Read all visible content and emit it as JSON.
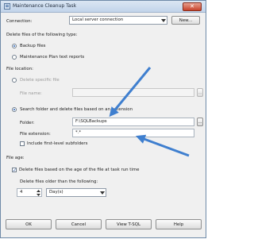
{
  "window": {
    "title": "Maintenance Cleanup Task",
    "close_label": "✕"
  },
  "connection": {
    "label": "Connection:",
    "selected": "Local server connection",
    "new_button": "New..."
  },
  "delete_type": {
    "heading": "Delete files of the following type:",
    "options": [
      {
        "label": "Backup files",
        "checked": true
      },
      {
        "label": "Maintenance Plan text reports",
        "checked": false
      }
    ]
  },
  "file_location": {
    "heading": "File location:",
    "specific": {
      "label": "Delete specific file",
      "checked": false
    },
    "file_name_label": "File name:",
    "file_name_value": "",
    "browse_label": "...",
    "search": {
      "label": "Search folder and delete files based on an extension",
      "checked": true
    },
    "folder_label": "Folder:",
    "folder_value": "F:\\SQLBackups",
    "folder_browse_label": "...",
    "extension_label": "File extension:",
    "extension_value": "*.*",
    "subfolders_label": "Include first-level subfolders",
    "subfolders_checked": false
  },
  "file_age": {
    "heading": "File age:",
    "delete_by_age_label": "Delete files based on the age of the file at task run time",
    "delete_by_age_checked": true,
    "older_than_label": "Delete files older than the following:",
    "amount": "4",
    "unit": "Day(s)"
  },
  "footer": {
    "ok": "OK",
    "cancel": "Cancel",
    "view_tsql": "View T-SQL",
    "help": "Help"
  },
  "annotations": {
    "arrow_color": "#3f7fcf"
  }
}
